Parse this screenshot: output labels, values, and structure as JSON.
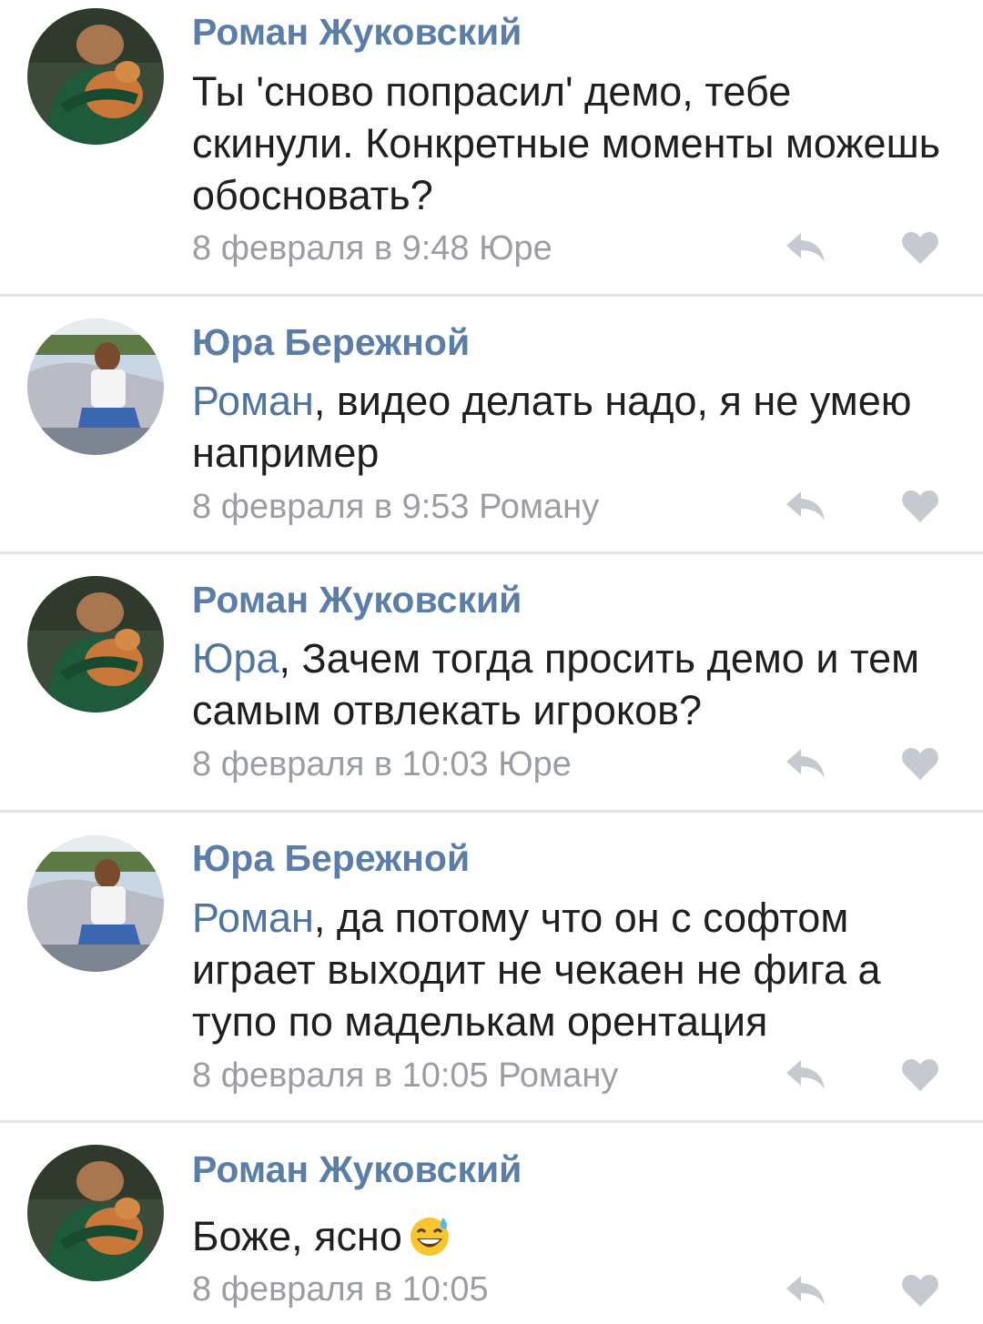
{
  "comments": [
    {
      "author": "Роман Жуковский",
      "avatar": "cat-holder-avatar",
      "mention": "",
      "text": "Ты 'сново попрасил' демо, тебе скинули. Конкретные моменты можешь обосновать?",
      "meta": "8 февраля в 9:48 Юре"
    },
    {
      "author": "Юра Бережной",
      "avatar": "outdoor-car-avatar",
      "mention": "Роман",
      "text": ", видео делать надо, я не умею например",
      "meta": "8 февраля в 9:53 Роману"
    },
    {
      "author": "Роман Жуковский",
      "avatar": "cat-holder-avatar",
      "mention": "Юра",
      "text": ", Зачем тогда просить демо и тем самым отвлекать игроков?",
      "meta": "8 февраля в 10:03 Юре"
    },
    {
      "author": "Юра Бережной",
      "avatar": "outdoor-car-avatar",
      "mention": "Роман",
      "text": ", да потому что он с софтом играет выходит не чекаен не фига а тупо по маделькам орентация",
      "meta": "8 февраля в 10:05 Роману"
    },
    {
      "author": "Роман Жуковский",
      "avatar": "cat-holder-avatar",
      "mention": "",
      "text": "Боже, ясно",
      "emoji": "grinning-sweat-emoji",
      "meta": "8 февраля в 10:05"
    }
  ],
  "icons": {
    "reply": "reply-icon",
    "like": "heart-icon"
  },
  "colors": {
    "author": "#5b7ea8",
    "mention": "#4f75a2",
    "text": "#1f1f1f",
    "meta": "#9a9ea4",
    "icon": "#c5c9d0",
    "divider": "#e3e4e8"
  }
}
